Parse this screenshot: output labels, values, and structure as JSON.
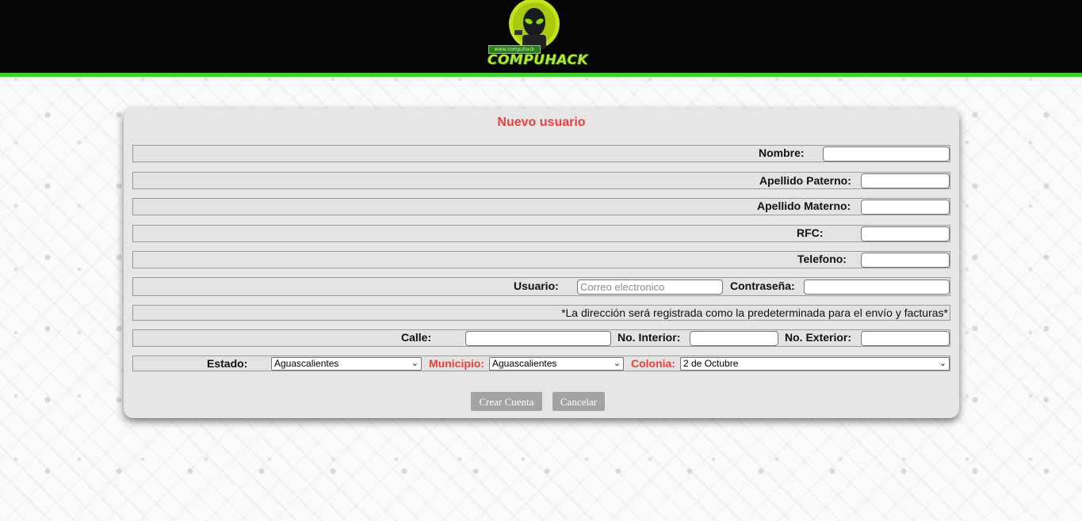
{
  "header": {
    "logo_text": "COMPUHACK",
    "logo_small_text": "www.compuhack",
    "accent_color": "#3cd42a"
  },
  "form": {
    "title": "Nuevo usuario",
    "nombre_label": "Nombre:",
    "nombre_value": "",
    "apellido_paterno_label": "Apellido Paterno:",
    "apellido_paterno_value": "",
    "apellido_materno_label": "Apellido Materno:",
    "apellido_materno_value": "",
    "rfc_label": "RFC:",
    "rfc_value": "",
    "telefono_label": "Telefono:",
    "telefono_value": "",
    "usuario_label": "Usuario:",
    "usuario_placeholder": "Correo electronico",
    "usuario_value": "",
    "contrasena_label": "Contraseña:",
    "contrasena_value": "",
    "address_note": "*La dirección será registrada como la predeterminada para el envío y facturas*",
    "calle_label": "Calle:",
    "calle_value": "",
    "no_interior_label": "No. Interior:",
    "no_interior_value": "",
    "no_exterior_label": "No. Exterior:",
    "no_exterior_value": "",
    "estado_label": "Estado:",
    "estado_selected": "Aguascalientes",
    "municipio_label": "Municipio:",
    "municipio_selected": "Aguascalientes",
    "colonia_label": "Colonia:",
    "colonia_selected": "2 de Octubre",
    "label_highlight_color": "#e8413c",
    "crear_button": "Crear Cuenta",
    "cancelar_button": "Cancelar"
  }
}
